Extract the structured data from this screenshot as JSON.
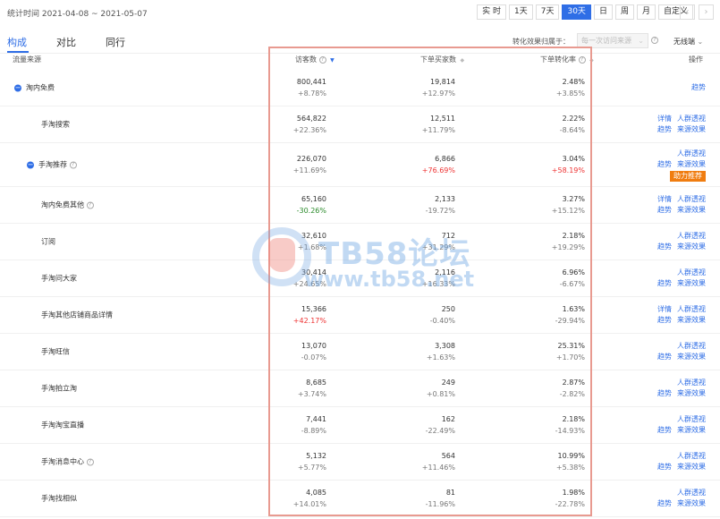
{
  "header": {
    "stat_time": "统计时间 2021-04-08 ~ 2021-05-07",
    "ranges": [
      "实 时",
      "1天",
      "7天",
      "30天",
      "日",
      "周",
      "月",
      "自定义"
    ],
    "active_range": "30天",
    "prev_icon": "chevron-left-icon",
    "next_icon": "chevron-right-icon"
  },
  "tabs": [
    "构成",
    "对比",
    "同行"
  ],
  "attribution": {
    "label": "转化效果归属于：",
    "select_value": "每一次访问来源",
    "wireless": "无线端"
  },
  "table": {
    "headers": {
      "source": "流量来源",
      "visitors": "访客数",
      "buyers": "下单买家数",
      "conversion": "下单转化率",
      "ops": "操作"
    },
    "rows": [
      {
        "name": "淘内免费",
        "visitors": "800,441",
        "visitors_chg": "+8.78%",
        "buyers": "19,814",
        "buyers_chg": "+12.97%",
        "conv": "2.48%",
        "conv_chg": "+3.85%"
      },
      {
        "name": "手淘搜索",
        "visitors": "564,822",
        "visitors_chg": "+22.36%",
        "buyers": "12,511",
        "buyers_chg": "+11.79%",
        "conv": "2.22%",
        "conv_chg": "-8.64%"
      },
      {
        "name": "手淘推荐",
        "visitors": "226,070",
        "visitors_chg": "+11.69%",
        "buyers": "6,866",
        "buyers_chg": "+76.69%",
        "conv": "3.04%",
        "conv_chg": "+58.19%"
      },
      {
        "name": "淘内免费其他",
        "visitors": "65,160",
        "visitors_chg": "-30.26%",
        "buyers": "2,133",
        "buyers_chg": "-19.72%",
        "conv": "3.27%",
        "conv_chg": "+15.12%"
      },
      {
        "name": "订阅",
        "visitors": "32,610",
        "visitors_chg": "+1.68%",
        "buyers": "712",
        "buyers_chg": "+31.29%",
        "conv": "2.18%",
        "conv_chg": "+19.29%"
      },
      {
        "name": "手淘问大家",
        "visitors": "30,414",
        "visitors_chg": "+24.65%",
        "buyers": "2,116",
        "buyers_chg": "+16.33%",
        "conv": "6.96%",
        "conv_chg": "-6.67%"
      },
      {
        "name": "手淘其他店铺商品详情",
        "visitors": "15,366",
        "visitors_chg": "+42.17%",
        "buyers": "250",
        "buyers_chg": "-0.40%",
        "conv": "1.63%",
        "conv_chg": "-29.94%"
      },
      {
        "name": "手淘旺信",
        "visitors": "13,070",
        "visitors_chg": "-0.07%",
        "buyers": "3,308",
        "buyers_chg": "+1.63%",
        "conv": "25.31%",
        "conv_chg": "+1.70%"
      },
      {
        "name": "手淘拍立淘",
        "visitors": "8,685",
        "visitors_chg": "+3.74%",
        "buyers": "249",
        "buyers_chg": "+0.81%",
        "conv": "2.87%",
        "conv_chg": "-2.82%"
      },
      {
        "name": "手淘淘宝直播",
        "visitors": "7,441",
        "visitors_chg": "-8.89%",
        "buyers": "162",
        "buyers_chg": "-22.49%",
        "conv": "2.18%",
        "conv_chg": "-14.93%"
      },
      {
        "name": "手淘消息中心",
        "visitors": "5,132",
        "visitors_chg": "+5.77%",
        "buyers": "564",
        "buyers_chg": "+11.46%",
        "conv": "10.99%",
        "conv_chg": "+5.38%"
      },
      {
        "name": "手淘找相似",
        "visitors": "4,085",
        "visitors_chg": "+14.01%",
        "buyers": "81",
        "buyers_chg": "-11.96%",
        "conv": "1.98%",
        "conv_chg": "-22.78%"
      }
    ],
    "ops": {
      "trend": "趋势",
      "detail": "详情",
      "crowd": "人群透视",
      "source_effect": "来源效果",
      "assist": "助力推荐"
    }
  },
  "watermark": {
    "title": "TB58论坛",
    "url": "www.tb58.net"
  },
  "colors": {
    "accent": "#2f6ee6",
    "increase_highlight": "#e33",
    "decrease_highlight": "#2a8a2a",
    "assist_badge": "#f07d10",
    "highlight_box": "#e89a90"
  }
}
